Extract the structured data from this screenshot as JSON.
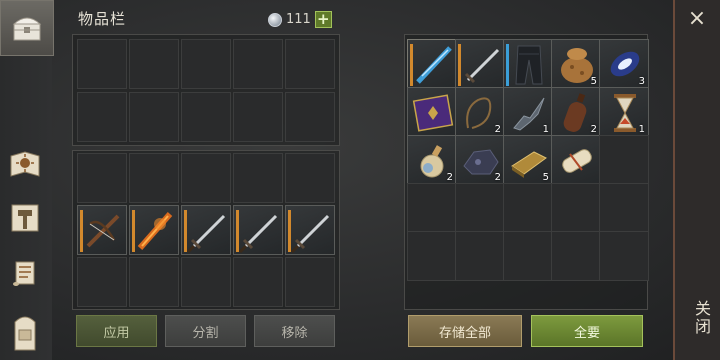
{
  "header": {
    "title": "物品栏",
    "currency_amount": "111",
    "add_currency_label": "+"
  },
  "tabs": [
    {
      "icon": "chest-icon",
      "active": true
    },
    {
      "icon": "sun-book-icon",
      "active": false
    },
    {
      "icon": "hammer-icon",
      "active": false
    },
    {
      "icon": "scroll-icon",
      "active": false
    },
    {
      "icon": "backpack-icon",
      "active": false
    }
  ],
  "left_panel": {
    "top_grid_rows": 2,
    "bottom_grid_items": [
      {
        "icon": "crossbow-icon",
        "quantity": "",
        "bar": "orange"
      },
      {
        "icon": "flaming-spear-icon",
        "quantity": "",
        "bar": "orange"
      },
      {
        "icon": "sword-icon",
        "quantity": "",
        "bar": "orange"
      },
      {
        "icon": "sword-icon",
        "quantity": "",
        "bar": "orange"
      },
      {
        "icon": "sword-icon",
        "quantity": "",
        "bar": "orange"
      }
    ],
    "buttons": {
      "apply": "应用",
      "split": "分割",
      "remove": "移除"
    }
  },
  "right_panel": {
    "items": [
      {
        "icon": "ice-spear-icon",
        "quantity": "",
        "bar": "orange"
      },
      {
        "icon": "sword-icon",
        "quantity": "",
        "bar": "orange"
      },
      {
        "icon": "leather-pants-icon",
        "quantity": "",
        "bar": "blue"
      },
      {
        "icon": "sack-icon",
        "quantity": "5",
        "bar": ""
      },
      {
        "icon": "crystal-gem-icon",
        "quantity": "3",
        "bar": ""
      },
      {
        "icon": "purple-book-icon",
        "quantity": "",
        "bar": ""
      },
      {
        "icon": "rope-icon",
        "quantity": "2",
        "bar": ""
      },
      {
        "icon": "bone-jaw-icon",
        "quantity": "1",
        "bar": ""
      },
      {
        "icon": "leather-flask-icon",
        "quantity": "2",
        "bar": ""
      },
      {
        "icon": "hourglass-icon",
        "quantity": "1",
        "bar": ""
      },
      {
        "icon": "potion-icon",
        "quantity": "2",
        "bar": ""
      },
      {
        "icon": "iron-ore-icon",
        "quantity": "2",
        "bar": ""
      },
      {
        "icon": "gold-ingot-icon",
        "quantity": "5",
        "bar": ""
      },
      {
        "icon": "parchment-roll-icon",
        "quantity": "",
        "bar": ""
      }
    ],
    "buttons": {
      "store_all": "存储全部",
      "take_all": "全要"
    }
  },
  "close": {
    "label": "关闭",
    "x": "×"
  },
  "colors": {
    "accent_green": "#6c7e3e",
    "bar_orange": "#d2892d",
    "bar_blue": "#3b9fd8"
  }
}
